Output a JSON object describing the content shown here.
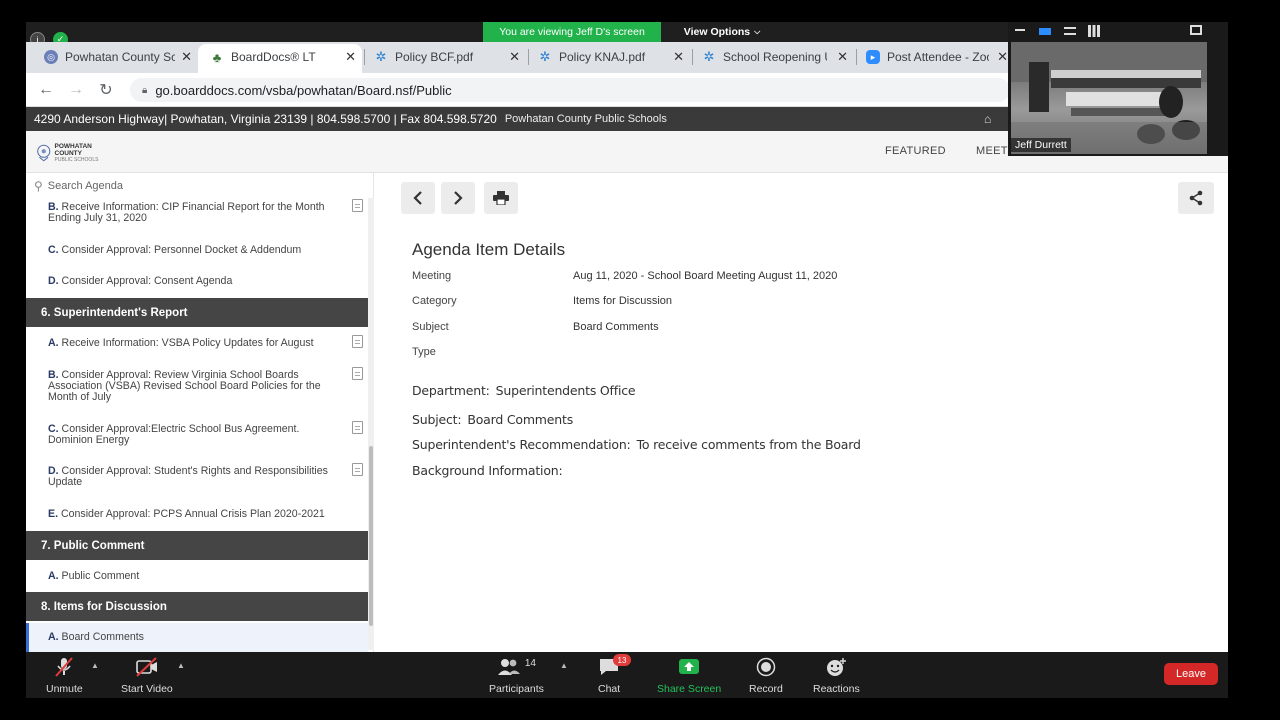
{
  "zoom": {
    "share_banner": "You are viewing Jeff D's screen",
    "view_options": "View Options",
    "participant_name": "Jeff Durrett",
    "toolbar": {
      "unmute": "Unmute",
      "start_video": "Start Video",
      "participants": "Participants",
      "participants_count": "14",
      "chat": "Chat",
      "chat_badge": "13",
      "share_screen": "Share Screen",
      "record": "Record",
      "reactions": "Reactions",
      "leave": "Leave"
    },
    "colors": {
      "green": "#22b24c",
      "leave_red": "#d42828",
      "badge_red": "#e23b3b"
    }
  },
  "browser": {
    "tabs": [
      {
        "label": "Powhatan County Sc",
        "icon": "globe-icon"
      },
      {
        "label": "BoardDocs® LT",
        "icon": "tree-icon"
      },
      {
        "label": "Policy BCF.pdf",
        "icon": "boarddocs-icon"
      },
      {
        "label": "Policy KNAJ.pdf",
        "icon": "boarddocs-icon"
      },
      {
        "label": "School Reopening U",
        "icon": "boarddocs-icon"
      },
      {
        "label": "Post Attendee - Zoo",
        "icon": "zoom-icon"
      }
    ],
    "url": "go.boarddocs.com/vsba/powhatan/Board.nsf/Public"
  },
  "site": {
    "address": "4290 Anderson Highway| Powhatan, Virginia 23139 | 804.598.5700 | Fax 804.598.5720",
    "org": "Powhatan County Public Schools",
    "logo_text": "POWHATAN COUNTY",
    "logo_sub": "PUBLIC SCHOOLS",
    "nav": {
      "featured": "FEATURED",
      "meetings": "MEETI"
    }
  },
  "sidebar": {
    "search_placeholder": "Search Agenda",
    "items": [
      {
        "letter": "B.",
        "text": "Receive Information: CIP Financial Report for the Month Ending July 31, 2020"
      },
      {
        "letter": "C.",
        "text": "Consider Approval: Personnel Docket & Addendum"
      },
      {
        "letter": "D.",
        "text": "Consider Approval: Consent Agenda"
      },
      {
        "letter": "A.",
        "text": "Receive Information: VSBA Policy Updates for August"
      },
      {
        "letter": "B.",
        "text": "Consider Approval: Review Virginia School Boards Association (VSBA) Revised School Board Policies for the Month of July"
      },
      {
        "letter": "C.",
        "text": "Consider Approval:Electric School Bus Agreement. Dominion Energy"
      },
      {
        "letter": "D.",
        "text": "Consider Approval: Student's Rights and Responsibilities Update"
      },
      {
        "letter": "E.",
        "text": "Consider Approval: PCPS Annual Crisis Plan 2020-2021"
      },
      {
        "letter": "A.",
        "text": "Public Comment"
      },
      {
        "letter": "A.",
        "text": "Board Comments"
      }
    ],
    "sections": [
      "6. Superintendent's Report",
      "7. Public Comment",
      "8. Items for Discussion"
    ]
  },
  "detail": {
    "title": "Agenda Item Details",
    "rows": [
      {
        "label": "Meeting",
        "value": "Aug 11, 2020 - School Board Meeting August 11, 2020"
      },
      {
        "label": "Category",
        "value": "Items for Discussion"
      },
      {
        "label": "Subject",
        "value": "Board Comments"
      },
      {
        "label": "Type",
        "value": ""
      }
    ],
    "body": [
      {
        "label": "Department:",
        "value": "Superintendents Office"
      },
      {
        "label": "Subject:",
        "value": "Board Comments"
      },
      {
        "label": "Superintendent's Recommendation:",
        "value": "To receive comments from the Board"
      },
      {
        "label": "Background Information:",
        "value": ""
      }
    ]
  }
}
